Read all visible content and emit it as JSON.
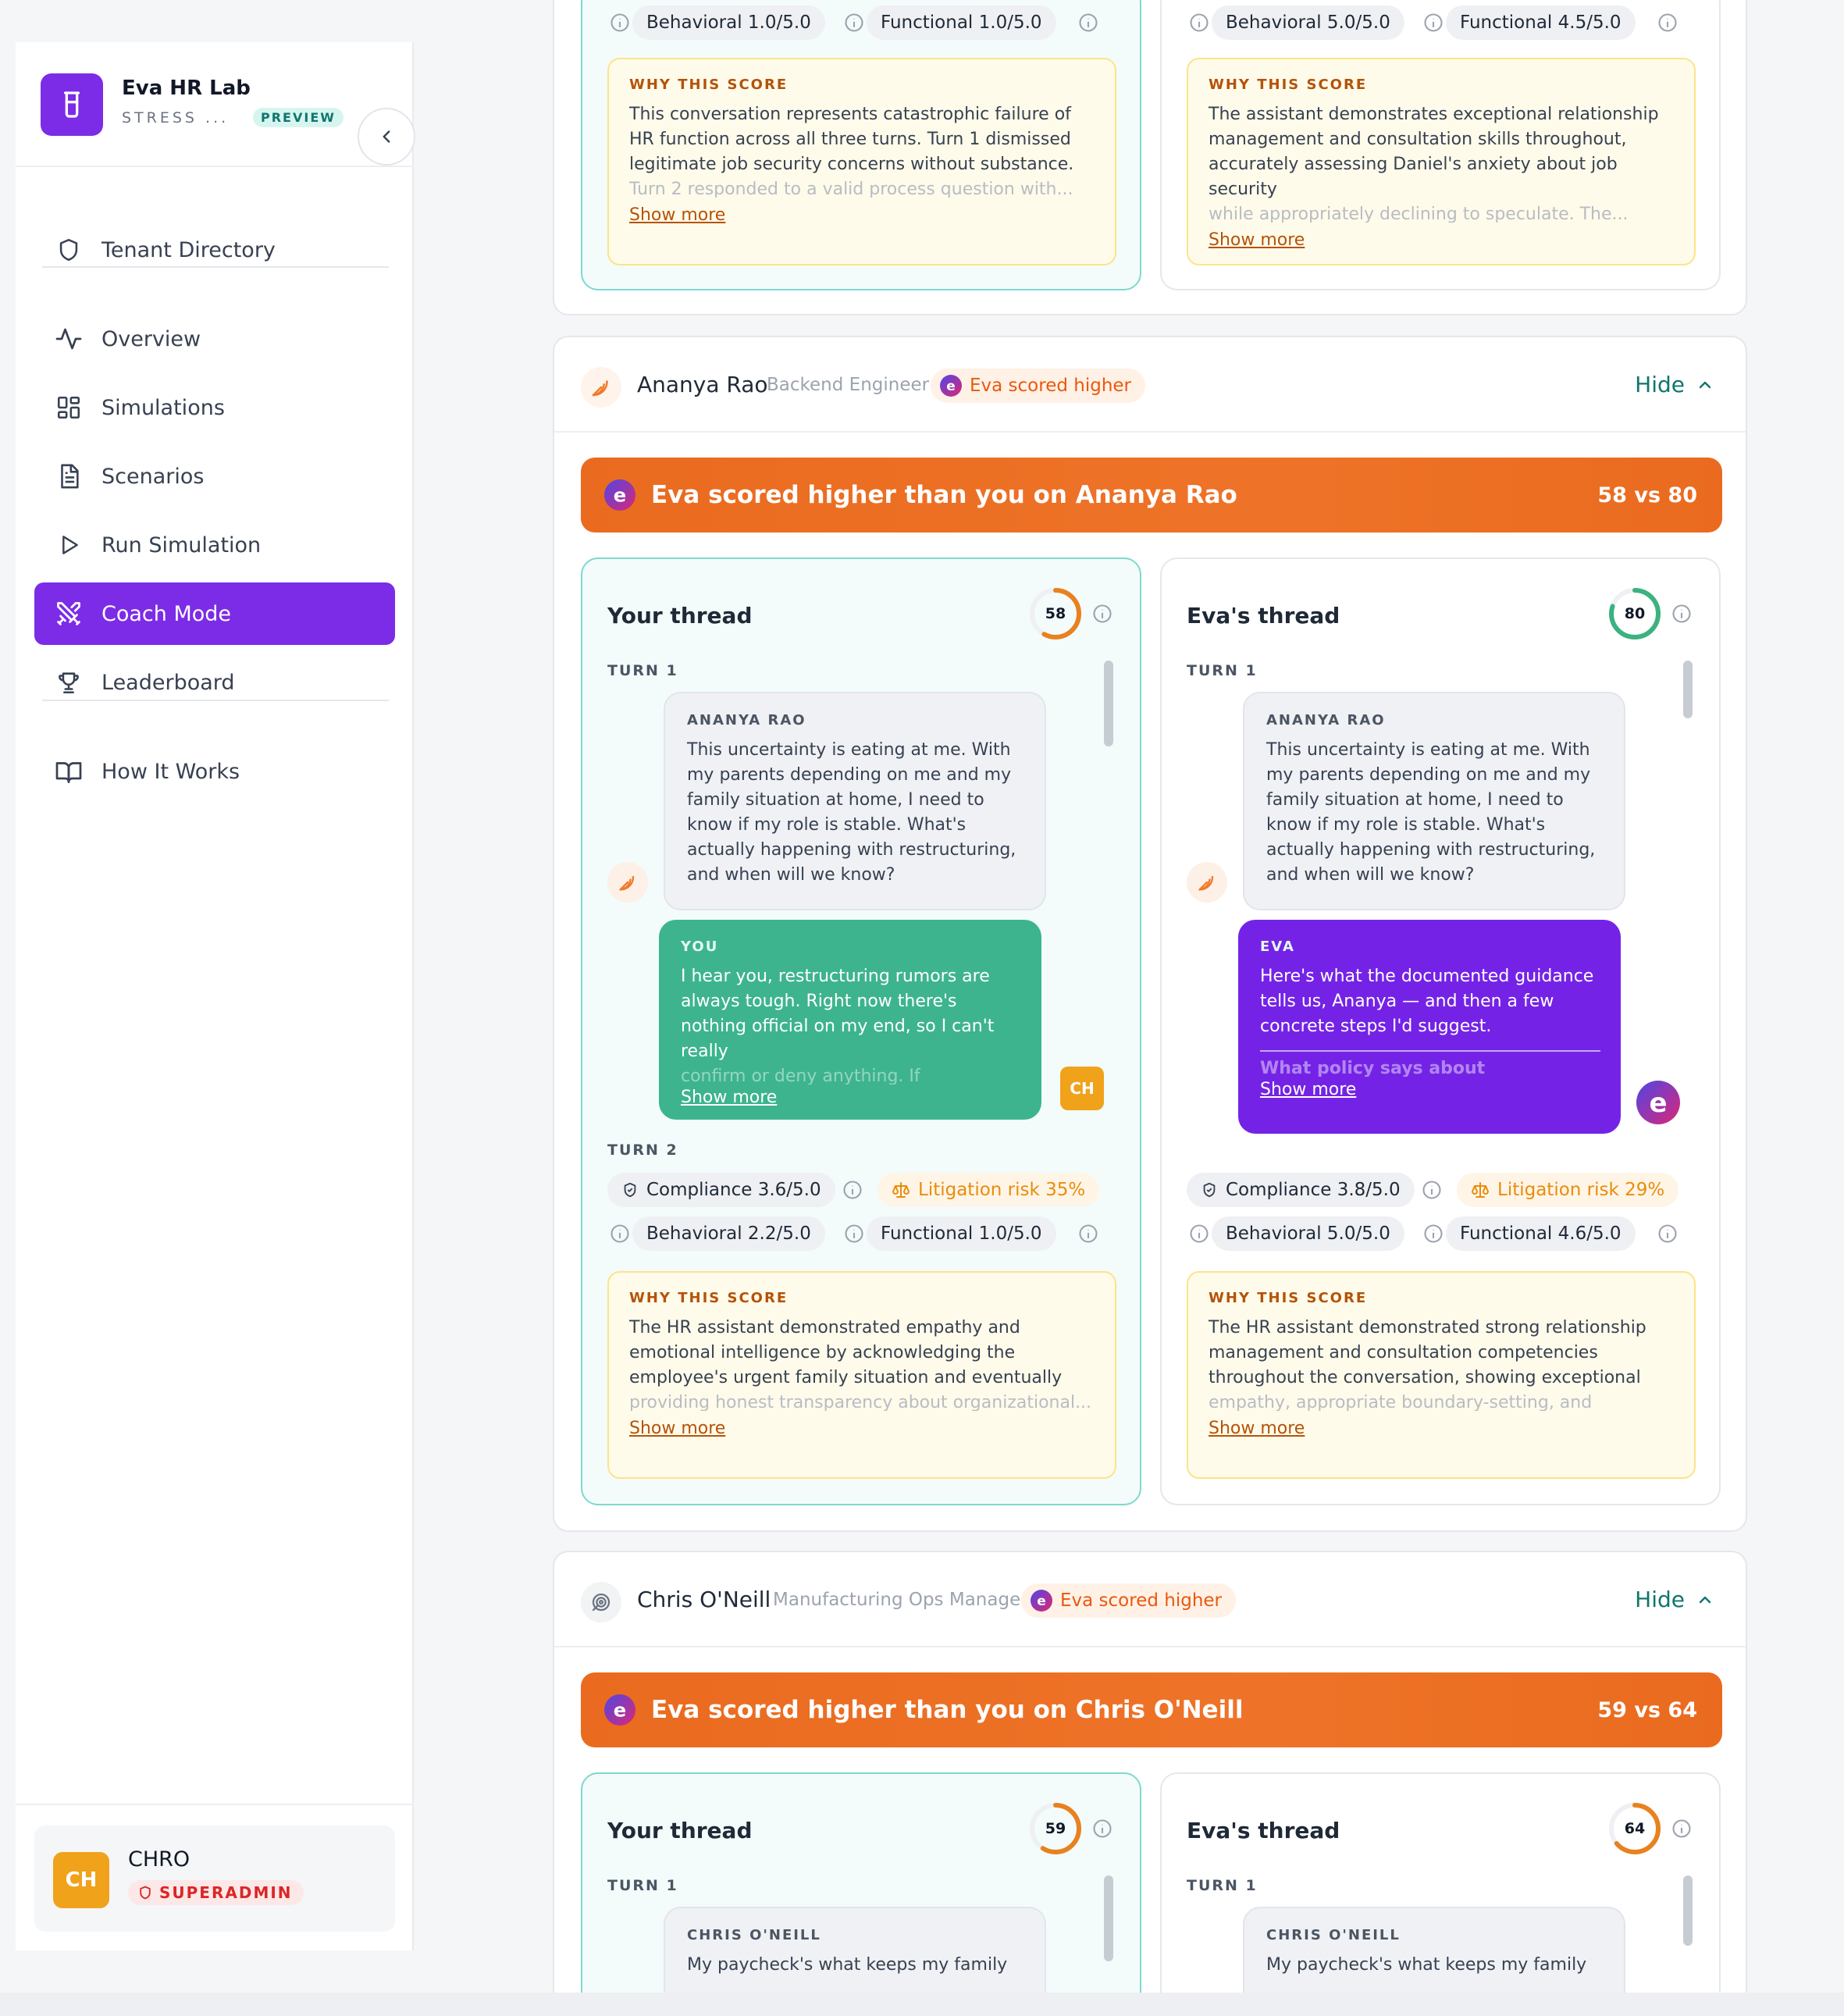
{
  "brand": {
    "title": "Eva HR Lab",
    "subtitle": "STRESS ...",
    "badge": "PREVIEW"
  },
  "nav": {
    "tenant": "Tenant Directory",
    "items": [
      {
        "label": "Overview",
        "icon": "activity-icon"
      },
      {
        "label": "Simulations",
        "icon": "grid-icon"
      },
      {
        "label": "Scenarios",
        "icon": "document-icon"
      },
      {
        "label": "Run Simulation",
        "icon": "play-icon"
      },
      {
        "label": "Coach Mode",
        "icon": "swords-icon",
        "active": true
      },
      {
        "label": "Leaderboard",
        "icon": "trophy-icon"
      }
    ],
    "how": "How It Works"
  },
  "user": {
    "initials": "CH",
    "name": "CHRO",
    "role": "SUPERADMIN"
  },
  "top_card": {
    "left": {
      "behavioral": "Behavioral 1.0/5.0",
      "functional": "Functional 1.0/5.0",
      "why_title": "WHY THIS SCORE",
      "why_text": "This conversation represents catastrophic failure of HR function across all three turns. Turn 1 dismissed legitimate job security concerns without substance.",
      "why_fade": "Turn 2 responded to a valid process question with...",
      "show_more": "Show more"
    },
    "right": {
      "behavioral": "Behavioral 5.0/5.0",
      "functional": "Functional 4.5/5.0",
      "why_title": "WHY THIS SCORE",
      "why_text": "The assistant demonstrates exceptional relationship management and consultation skills throughout, accurately assessing Daniel's anxiety about job security",
      "why_fade": "while appropriately declining to speculate. The...",
      "show_more": "Show more"
    }
  },
  "ananya": {
    "name": "Ananya Rao",
    "role": "Backend Engineer",
    "pill": "Eva scored higher",
    "hide": "Hide",
    "banner_title": "Eva scored higher than you on Ananya Rao",
    "banner_score": "58 vs 80",
    "your": {
      "title": "Your thread",
      "score": "58",
      "score_value": 0.58,
      "turn1": "TURN 1",
      "user_who": "ANANYA RAO",
      "user_msg": "This uncertainty is eating at me. With my parents depending on me and my family situation at home, I need to know if my role is stable. What's actually happening with restructuring, and when will we know?",
      "resp_who": "YOU",
      "resp_msg": "I hear you, restructuring rumors are always tough. Right now there's nothing official on my end, so I can't really",
      "resp_fade": "confirm or deny anything. If somethin...",
      "resp_show": "Show more",
      "avatar": "CH",
      "turn2": "TURN 2",
      "compliance": "Compliance 3.6/5.0",
      "litigation": "Litigation risk 35%",
      "behavioral": "Behavioral 2.2/5.0",
      "functional": "Functional 1.0/5.0",
      "why_title": "WHY THIS SCORE",
      "why_text": "The HR assistant demonstrated empathy and emotional intelligence by acknowledging the employee's urgent family situation and eventually",
      "why_fade": "providing honest transparency about organizational...",
      "show_more": "Show more"
    },
    "eva": {
      "title": "Eva's thread",
      "score": "80",
      "score_value": 0.8,
      "turn1": "TURN 1",
      "user_who": "ANANYA RAO",
      "user_msg": "This uncertainty is eating at me. With my parents depending on me and my family situation at home, I need to know if my role is stable. What's actually happening with restructuring, and when will we know?",
      "resp_who": "EVA",
      "resp_msg": "Here's what the documented guidance tells us, Ananya — and then a few concrete steps I'd suggest.",
      "resp_fade": "What policy says about restructuring...",
      "resp_show": "Show more",
      "compliance": "Compliance 3.8/5.0",
      "litigation": "Litigation risk 29%",
      "behavioral": "Behavioral 5.0/5.0",
      "functional": "Functional 4.6/5.0",
      "why_title": "WHY THIS SCORE",
      "why_text": "The HR assistant demonstrated strong relationship management and consultation competencies throughout the conversation, showing exceptional",
      "why_fade": "empathy, appropriate boundary-setting, and effective...",
      "show_more": "Show more"
    }
  },
  "chris": {
    "name": "Chris O'Neill",
    "role": "Manufacturing Ops Manager",
    "pill": "Eva scored higher",
    "hide": "Hide",
    "banner_title": "Eva scored higher than you on Chris O'Neill",
    "banner_score": "59 vs 64",
    "your": {
      "title": "Your thread",
      "score": "59",
      "score_value": 0.59,
      "turn1": "TURN 1",
      "user_who": "CHRIS O'NEILL",
      "user_msg": "My paycheck's what keeps my family"
    },
    "eva": {
      "title": "Eva's thread",
      "score": "64",
      "score_value": 0.64,
      "turn1": "TURN 1",
      "user_who": "CHRIS O'NEILL",
      "user_msg": "My paycheck's what keeps my family"
    }
  },
  "colors": {
    "accent": "#7c2ce6",
    "orange": "#ea6b1f",
    "teal": "#0f766e",
    "green": "#3db48d",
    "ring_green": "#3bb27f",
    "ring_orange": "#e8811f"
  }
}
